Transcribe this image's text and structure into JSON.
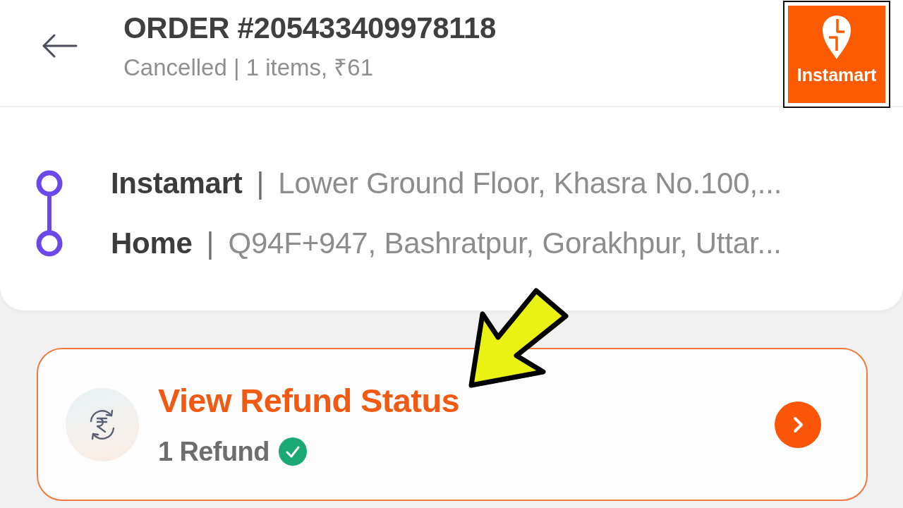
{
  "header": {
    "title": "ORDER #205433409978118",
    "subtitle": "Cancelled | 1 items, ₹61"
  },
  "logo": {
    "text": "Instamart"
  },
  "route": [
    {
      "name": "Instamart",
      "separator": "|",
      "address": "Lower Ground Floor, Khasra No.100,..."
    },
    {
      "name": "Home",
      "separator": "|",
      "address": "Q94F+947, Bashratpur, Gorakhpur, Uttar..."
    }
  ],
  "refund": {
    "title": "View Refund Status",
    "count": "1 Refund",
    "verified": true
  }
}
